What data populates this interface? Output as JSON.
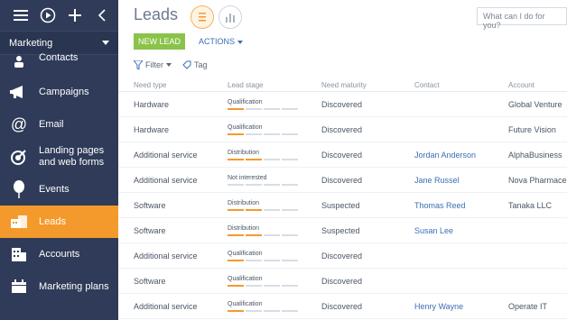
{
  "sidebar": {
    "section": "Marketing",
    "items": [
      {
        "label": "Contacts",
        "icon": "person-icon"
      },
      {
        "label": "Campaigns",
        "icon": "megaphone-icon"
      },
      {
        "label": "Email",
        "icon": "at-icon"
      },
      {
        "label": "Landing pages",
        "label2": "and web forms",
        "icon": "target-icon"
      },
      {
        "label": "Events",
        "icon": "balloon-icon"
      },
      {
        "label": "Leads",
        "icon": "leads-icon"
      },
      {
        "label": "Accounts",
        "icon": "building-icon"
      },
      {
        "label": "Marketing plans",
        "icon": "calendar-icon"
      }
    ]
  },
  "main": {
    "title": "Leads",
    "search_placeholder": "What can I do for you?",
    "new_lead": "NEW LEAD",
    "actions": "ACTIONS",
    "filter": "Filter",
    "tag": "Tag"
  },
  "table": {
    "headers": [
      "Need type",
      "Lead stage",
      "Need maturity",
      "Contact",
      "Account"
    ],
    "rows": [
      {
        "need": "Hardware",
        "stage": "Qualification",
        "progress": 1,
        "maturity": "Discovered",
        "contact": "",
        "account": "Global Venture"
      },
      {
        "need": "Hardware",
        "stage": "Qualification",
        "progress": 1,
        "maturity": "Discovered",
        "contact": "",
        "account": "Future Vision"
      },
      {
        "need": "Additional service",
        "stage": "Distribution",
        "progress": 2,
        "maturity": "Discovered",
        "contact": "Jordan Anderson",
        "account": "AlphaBusiness"
      },
      {
        "need": "Additional service",
        "stage": "Not interested",
        "progress": 0,
        "maturity": "Discovered",
        "contact": "Jane Russel",
        "account": "Nova Pharmaceu"
      },
      {
        "need": "Software",
        "stage": "Distribution",
        "progress": 2,
        "maturity": "Suspected",
        "contact": "Thomas Reed",
        "account": "Tanaka LLC"
      },
      {
        "need": "Software",
        "stage": "Distribution",
        "progress": 2,
        "maturity": "Suspected",
        "contact": "Susan Lee",
        "account": ""
      },
      {
        "need": "Additional service",
        "stage": "Qualification",
        "progress": 1,
        "maturity": "Discovered",
        "contact": "",
        "account": ""
      },
      {
        "need": "Software",
        "stage": "Qualification",
        "progress": 1,
        "maturity": "Discovered",
        "contact": "",
        "account": ""
      },
      {
        "need": "Additional service",
        "stage": "Qualification",
        "progress": 1,
        "maturity": "Discovered",
        "contact": "Henry Wayne",
        "account": "Operate IT"
      }
    ]
  },
  "colors": {
    "sidebar": "#2f3b58",
    "accent": "#f49a2c",
    "new_lead": "#8bc24a",
    "link": "#3a6fb5"
  }
}
